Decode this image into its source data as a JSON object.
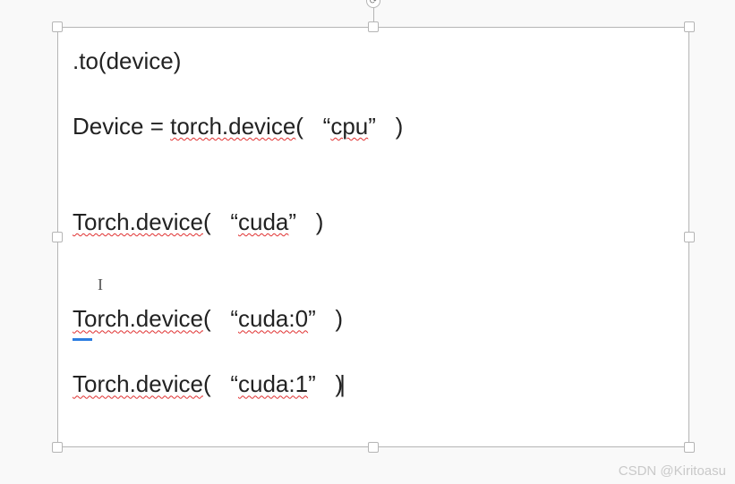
{
  "editor": {
    "rotate_glyph": "⟳",
    "lines": {
      "l1_text": ".to(device)",
      "l2_pre": "Device = ",
      "l2_squig": "torch.device",
      "l2_open": "(   ",
      "l2_quote_l": "“",
      "l2_arg": "cpu",
      "l2_quote_r": "”",
      "l2_close": "   )",
      "l3_squig": "Torch.device",
      "l3_open": "(   ",
      "l3_quote_l": "“",
      "l3_arg": "cuda",
      "l3_quote_r": "”",
      "l3_close": "   )",
      "cursor_i": "I",
      "l4_squig": "Torch.device",
      "l4_open": "(   ",
      "l4_quote_l": "“",
      "l4_arg": "cuda:0",
      "l4_quote_r": "”",
      "l4_close": "   )",
      "l5_squig": "Torch.device",
      "l5_open": "(   ",
      "l5_quote_l": "“",
      "l5_arg": "cuda:1",
      "l5_quote_r": "”",
      "l5_close": "   )"
    }
  },
  "watermarks": {
    "bottom": "CSDN @Kiritoasu"
  }
}
